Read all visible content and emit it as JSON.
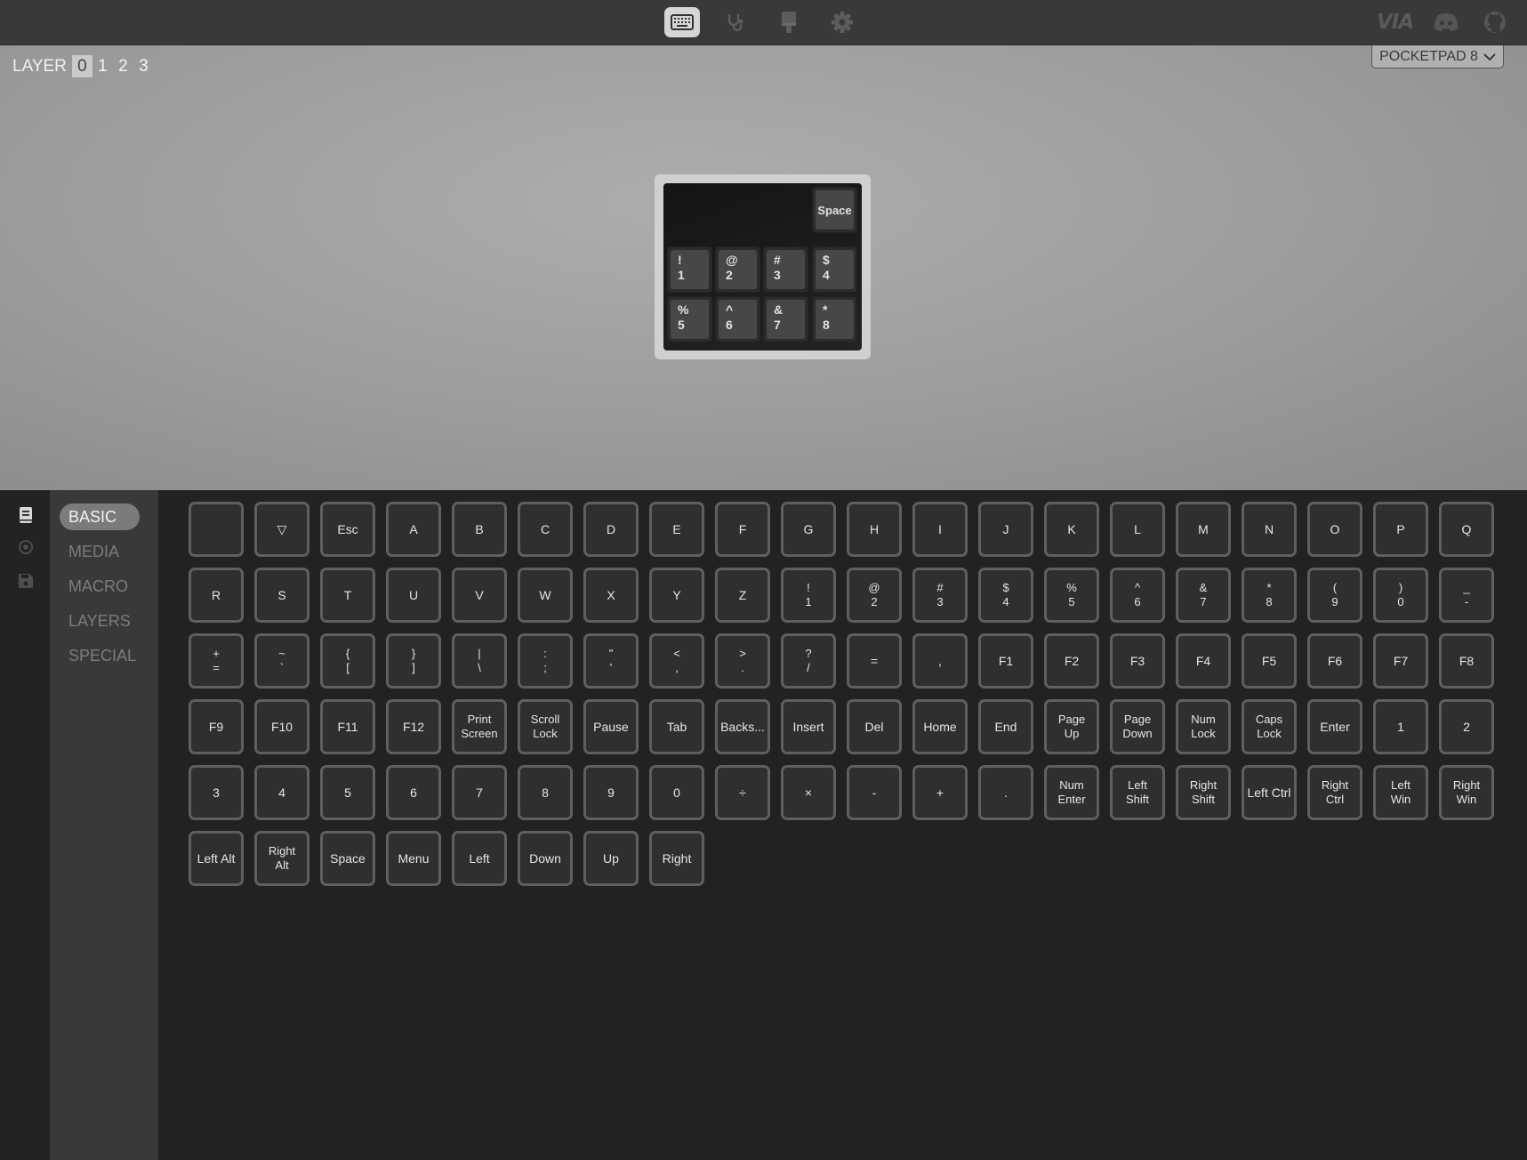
{
  "nav": {
    "icons": [
      "keyboard-icon",
      "stethoscope-icon",
      "paintbrush-icon",
      "gear-icon"
    ],
    "active": "keyboard-icon",
    "brand": {
      "logo_text": "VIA",
      "icons": [
        "discord-icon",
        "github-icon"
      ]
    }
  },
  "layers": {
    "label": "LAYER",
    "items": [
      "0",
      "1",
      "2",
      "3"
    ],
    "active": "0"
  },
  "device": {
    "name": "POCKETPAD 8"
  },
  "keyboard": {
    "keys": [
      {
        "top": "",
        "bottom": "Space",
        "center": true
      },
      {
        "top": "!",
        "bottom": "1"
      },
      {
        "top": "@",
        "bottom": "2"
      },
      {
        "top": "#",
        "bottom": "3"
      },
      {
        "top": "$",
        "bottom": "4"
      },
      {
        "top": "%",
        "bottom": "5"
      },
      {
        "top": "^",
        "bottom": "6"
      },
      {
        "top": "&",
        "bottom": "7"
      },
      {
        "top": "*",
        "bottom": "8"
      }
    ]
  },
  "rail": {
    "icons": [
      "book-icon",
      "circle-dot-icon",
      "save-icon"
    ]
  },
  "categories": {
    "items": [
      "BASIC",
      "MEDIA",
      "MACRO",
      "LAYERS",
      "SPECIAL"
    ],
    "active": "BASIC"
  },
  "keycodes": [
    "",
    "▽",
    "Esc",
    "A",
    "B",
    "C",
    "D",
    "E",
    "F",
    "G",
    "H",
    "I",
    "J",
    "K",
    "L",
    "M",
    "N",
    "O",
    "P",
    "Q",
    "R",
    "S",
    "T",
    "U",
    "V",
    "W",
    "X",
    "Y",
    "Z",
    "!\n1",
    "@\n2",
    "#\n3",
    "$\n4",
    "%\n5",
    "^\n6",
    "&\n7",
    "*\n8",
    "(\n9",
    ")\n0",
    "_\n-",
    "+\n=",
    "~\n`",
    "{\n[",
    "}\n]",
    "|\n\\",
    ":\n;",
    "\"\n'",
    "<\n,",
    ">\n.",
    "?\n/",
    "=",
    ",",
    "F1",
    "F2",
    "F3",
    "F4",
    "F5",
    "F6",
    "F7",
    "F8",
    "F9",
    "F10",
    "F11",
    "F12",
    "Print\nScreen",
    "Scroll\nLock",
    "Pause",
    "Tab",
    "Backs...",
    "Insert",
    "Del",
    "Home",
    "End",
    "Page\nUp",
    "Page\nDown",
    "Num\nLock",
    "Caps\nLock",
    "Enter",
    "1",
    "2",
    "3",
    "4",
    "5",
    "6",
    "7",
    "8",
    "9",
    "0",
    "÷",
    "×",
    "-",
    "+",
    ".",
    "Num\nEnter",
    "Left\nShift",
    "Right\nShift",
    "Left Ctrl",
    "Right\nCtrl",
    "Left\nWin",
    "Right\nWin",
    "Left Alt",
    "Right\nAlt",
    "Space",
    "Menu",
    "Left",
    "Down",
    "Up",
    "Right"
  ]
}
